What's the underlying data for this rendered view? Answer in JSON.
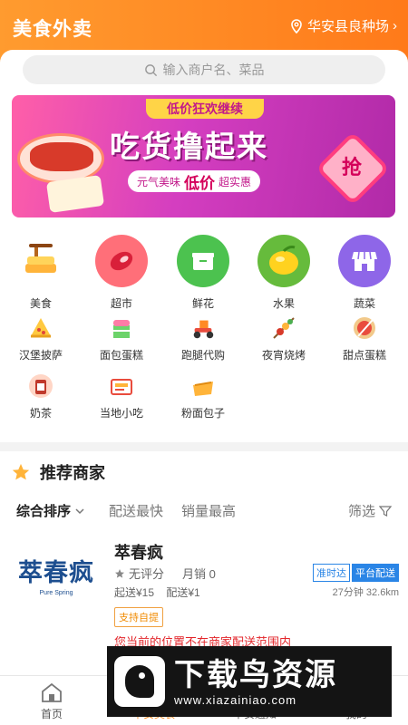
{
  "header": {
    "title": "美食外卖",
    "location": "华安县良种场"
  },
  "search": {
    "placeholder": "输入商户名、菜品"
  },
  "banner": {
    "tag": "低价狂欢继续",
    "headline": "吃货撸起来",
    "sub_left": "元气美味",
    "sub_em": "低价",
    "sub_right": "超实惠",
    "grab": "抢"
  },
  "categories": {
    "big": [
      {
        "label": "美食",
        "icon": "cake-icon",
        "color": "#ffffff"
      },
      {
        "label": "超市",
        "icon": "meat-icon",
        "color": "#ff6f79"
      },
      {
        "label": "鲜花",
        "icon": "box-icon",
        "color": "#4cc24f"
      },
      {
        "label": "水果",
        "icon": "lemon-icon",
        "color": "#66bb3c"
      },
      {
        "label": "蔬菜",
        "icon": "store-icon",
        "color": "#8e66e8"
      }
    ],
    "small": [
      {
        "label": "汉堡披萨",
        "icon": "pizza-icon"
      },
      {
        "label": "面包蛋糕",
        "icon": "cake-slice-icon"
      },
      {
        "label": "跑腿代购",
        "icon": "scooter-icon"
      },
      {
        "label": "夜宵烧烤",
        "icon": "skewer-icon"
      },
      {
        "label": "甜点蛋糕",
        "icon": "dessert-icon"
      },
      {
        "label": "奶茶",
        "icon": "tea-icon"
      },
      {
        "label": "当地小吃",
        "icon": "snack-icon"
      },
      {
        "label": "粉面包子",
        "icon": "noodle-icon"
      }
    ]
  },
  "recommend": {
    "title": "推荐商家",
    "sort": {
      "default": "综合排序",
      "fast": "配送最快",
      "sales": "销量最高",
      "filter": "筛选"
    }
  },
  "merchant": {
    "logo_text": "萃春疯",
    "logo_sub": "Pure Spring",
    "name": "萃春疯",
    "rating": "无评分",
    "sales": "月销 0",
    "min_order": "起送¥15",
    "delivery_fee": "配送¥1",
    "badge_ontime": "准时达",
    "badge_platform": "平台配送",
    "distance": "27分钟 32.6km",
    "self_pickup": "支持自提",
    "warning": "您当前的位置不在商家配送范围内"
  },
  "nav": {
    "home": "首页",
    "merchants": "平安美食",
    "notice": "平安通知",
    "mine": "我的"
  },
  "watermark": {
    "text": "下载鸟资源",
    "url": "www.xiazainiao.com"
  },
  "colors": {
    "primary": "#ff8a24",
    "accent_blue": "#2a85e6",
    "warn": "#e3262b"
  }
}
